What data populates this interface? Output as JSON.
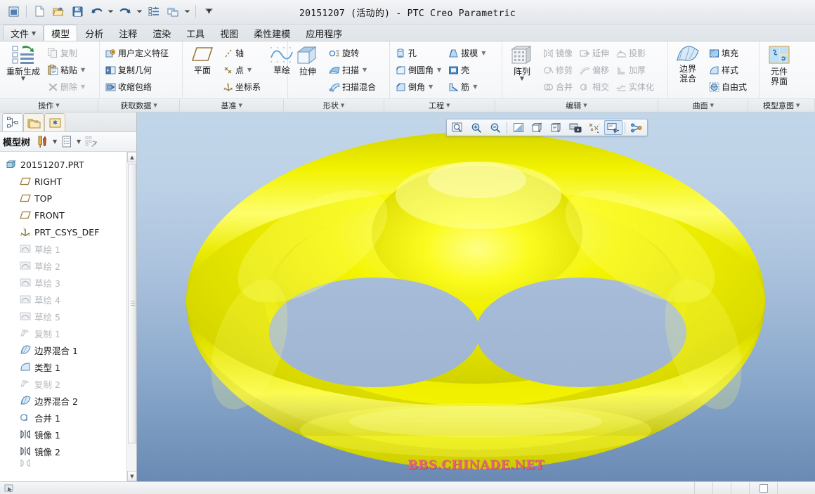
{
  "window": {
    "title": "20151207 (活动的) - PTC Creo Parametric"
  },
  "quick_access": {
    "buttons": [
      {
        "name": "window-restore-icon",
        "label": "窗口"
      },
      {
        "name": "new-file-icon",
        "label": "新建"
      },
      {
        "name": "open-file-icon",
        "label": "打开"
      },
      {
        "name": "save-icon",
        "label": "保存"
      },
      {
        "name": "undo-icon",
        "label": "撤消"
      },
      {
        "name": "redo-icon",
        "label": "重做"
      },
      {
        "name": "regenerate-icon",
        "label": "重新生成"
      },
      {
        "name": "window-switch-icon",
        "label": "窗口切换"
      },
      {
        "name": "customize-qat-icon",
        "label": "自定义快速访问工具栏"
      }
    ]
  },
  "ribbon": {
    "tabs": [
      {
        "label": "文件",
        "has_caret": true,
        "active": false,
        "is_file": true
      },
      {
        "label": "模型",
        "has_caret": false,
        "active": true,
        "is_file": false
      },
      {
        "label": "分析",
        "has_caret": false,
        "active": false,
        "is_file": false
      },
      {
        "label": "注释",
        "has_caret": false,
        "active": false,
        "is_file": false
      },
      {
        "label": "渲染",
        "has_caret": false,
        "active": false,
        "is_file": false
      },
      {
        "label": "工具",
        "has_caret": false,
        "active": false,
        "is_file": false
      },
      {
        "label": "视图",
        "has_caret": false,
        "active": false,
        "is_file": false
      },
      {
        "label": "柔性建模",
        "has_caret": false,
        "active": false,
        "is_file": false
      },
      {
        "label": "应用程序",
        "has_caret": false,
        "active": false,
        "is_file": false
      }
    ],
    "groups": [
      {
        "label": "操作",
        "big": {
          "label_line1": "重新生成",
          "label_line2": "",
          "icon": "regenerate-icon",
          "has_dropdown": true
        },
        "items": [
          {
            "label": "复制",
            "icon": "copy-icon",
            "dimmed": true,
            "dropdown": false
          },
          {
            "label": "粘贴",
            "icon": "paste-icon",
            "dimmed": false,
            "dropdown": true
          },
          {
            "label": "删除",
            "icon": "delete-icon",
            "dimmed": true,
            "dropdown": true
          }
        ]
      },
      {
        "label": "获取数据",
        "big": null,
        "items": [
          {
            "label": "用户定义特征",
            "icon": "udf-icon",
            "dimmed": false,
            "dropdown": false
          },
          {
            "label": "复制几何",
            "icon": "copy-geometry-icon",
            "dimmed": false,
            "dropdown": false
          },
          {
            "label": "收缩包络",
            "icon": "shrinkwrap-icon",
            "dimmed": false,
            "dropdown": false
          }
        ]
      },
      {
        "label": "基准",
        "big": {
          "label_line1": "平面",
          "label_line2": "",
          "icon": "datum-plane-icon",
          "has_dropdown": false
        },
        "items": [
          {
            "label": "轴",
            "icon": "datum-axis-icon",
            "dimmed": false,
            "dropdown": false
          },
          {
            "label": "点",
            "icon": "datum-point-icon",
            "dimmed": false,
            "dropdown": true
          },
          {
            "label": "坐标系",
            "icon": "coordinate-system-icon",
            "dimmed": false,
            "dropdown": false
          }
        ],
        "big2": {
          "label_line1": "草绘",
          "label_line2": "",
          "icon": "sketch-icon",
          "has_dropdown": false
        }
      },
      {
        "label": "形状",
        "big": {
          "label_line1": "拉伸",
          "label_line2": "",
          "icon": "extrude-icon",
          "has_dropdown": false
        },
        "items": [
          {
            "label": "旋转",
            "icon": "revolve-icon",
            "dimmed": false,
            "dropdown": false
          },
          {
            "label": "扫描",
            "icon": "sweep-icon",
            "dimmed": false,
            "dropdown": true
          },
          {
            "label": "扫描混合",
            "icon": "swept-blend-icon",
            "dimmed": false,
            "dropdown": false
          }
        ]
      },
      {
        "label": "工程",
        "big": null,
        "items": [
          {
            "label": "孔",
            "icon": "hole-icon",
            "dimmed": false,
            "dropdown": false
          },
          {
            "label": "倒圆角",
            "icon": "round-icon",
            "dimmed": false,
            "dropdown": true
          },
          {
            "label": "倒角",
            "icon": "chamfer-icon",
            "dimmed": false,
            "dropdown": true
          }
        ],
        "items2": [
          {
            "label": "拔模",
            "icon": "draft-icon",
            "dimmed": false,
            "dropdown": true
          },
          {
            "label": "壳",
            "icon": "shell-icon",
            "dimmed": false,
            "dropdown": false
          },
          {
            "label": "筋",
            "icon": "rib-icon",
            "dimmed": false,
            "dropdown": true
          }
        ]
      },
      {
        "label": "编辑",
        "big": {
          "label_line1": "阵列",
          "label_line2": "",
          "icon": "pattern-icon",
          "has_dropdown": true
        },
        "items": [
          {
            "label": "镜像",
            "icon": "mirror-icon",
            "dimmed": true,
            "dropdown": false
          },
          {
            "label": "修剪",
            "icon": "trim-icon",
            "dimmed": true,
            "dropdown": false
          },
          {
            "label": "合并",
            "icon": "merge-icon",
            "dimmed": true,
            "dropdown": false
          }
        ],
        "items2": [
          {
            "label": "延伸",
            "icon": "extend-icon",
            "dimmed": true,
            "dropdown": false
          },
          {
            "label": "偏移",
            "icon": "offset-icon",
            "dimmed": true,
            "dropdown": false
          },
          {
            "label": "相交",
            "icon": "intersect-icon",
            "dimmed": true,
            "dropdown": false
          }
        ],
        "items3": [
          {
            "label": "投影",
            "icon": "project-icon",
            "dimmed": true,
            "dropdown": false
          },
          {
            "label": "加厚",
            "icon": "thicken-icon",
            "dimmed": true,
            "dropdown": false
          },
          {
            "label": "实体化",
            "icon": "solidify-icon",
            "dimmed": true,
            "dropdown": false
          }
        ]
      },
      {
        "label": "曲面",
        "big": {
          "label_line1": "边界",
          "label_line2": "混合",
          "icon": "boundary-blend-icon",
          "has_dropdown": false
        },
        "items": [
          {
            "label": "填充",
            "icon": "fill-icon",
            "dimmed": false,
            "dropdown": false
          },
          {
            "label": "样式",
            "icon": "style-icon",
            "dimmed": false,
            "dropdown": false
          },
          {
            "label": "自由式",
            "icon": "freestyle-icon",
            "dimmed": false,
            "dropdown": false
          }
        ]
      },
      {
        "label": "模型意图",
        "big": {
          "label_line1": "元件",
          "label_line2": "界面",
          "icon": "component-interface-icon",
          "has_dropdown": false
        },
        "items": []
      }
    ]
  },
  "navigator": {
    "tabs": [
      {
        "name": "model-tree-tab",
        "label": "模型树",
        "state": "active"
      },
      {
        "name": "folder-browser-tab",
        "label": "文件夹浏览器",
        "state": "selected"
      },
      {
        "name": "favorites-tab",
        "label": "收藏夹",
        "state": "selected"
      }
    ],
    "tree_title": "模型树",
    "toolbar": [
      {
        "name": "tree-settings-icon",
        "label": "设置",
        "caret": true
      },
      {
        "name": "tree-display-icon",
        "label": "显示",
        "caret": true
      },
      {
        "name": "tree-filter-icon",
        "label": "过滤器",
        "caret": false
      }
    ],
    "tree": [
      {
        "label": "20151207.PRT",
        "icon": "part-icon",
        "level": 0,
        "dimmed": false
      },
      {
        "label": "RIGHT",
        "icon": "datum-plane-icon",
        "level": 1,
        "dimmed": false
      },
      {
        "label": "TOP",
        "icon": "datum-plane-icon",
        "level": 1,
        "dimmed": false
      },
      {
        "label": "FRONT",
        "icon": "datum-plane-icon",
        "level": 1,
        "dimmed": false
      },
      {
        "label": "PRT_CSYS_DEF",
        "icon": "coordinate-system-icon",
        "level": 1,
        "dimmed": false
      },
      {
        "label": "草绘 1",
        "icon": "sketch-feature-icon",
        "level": 1,
        "dimmed": true
      },
      {
        "label": "草绘 2",
        "icon": "sketch-feature-icon",
        "level": 1,
        "dimmed": true
      },
      {
        "label": "草绘 3",
        "icon": "sketch-feature-icon",
        "level": 1,
        "dimmed": true
      },
      {
        "label": "草绘 4",
        "icon": "sketch-feature-icon",
        "level": 1,
        "dimmed": true
      },
      {
        "label": "草绘 5",
        "icon": "sketch-feature-icon",
        "level": 1,
        "dimmed": true
      },
      {
        "label": "复制 1",
        "icon": "copy-feature-icon",
        "level": 1,
        "dimmed": true
      },
      {
        "label": "边界混合 1",
        "icon": "boundary-blend-feature-icon",
        "level": 1,
        "dimmed": false
      },
      {
        "label": "类型 1",
        "icon": "style-feature-icon",
        "level": 1,
        "dimmed": false
      },
      {
        "label": "复制 2",
        "icon": "copy-feature-icon",
        "level": 1,
        "dimmed": true
      },
      {
        "label": "边界混合 2",
        "icon": "boundary-blend-feature-icon",
        "level": 1,
        "dimmed": false
      },
      {
        "label": "合并 1",
        "icon": "merge-feature-icon",
        "level": 1,
        "dimmed": false
      },
      {
        "label": "镜像 1",
        "icon": "mirror-feature-icon",
        "level": 1,
        "dimmed": false
      },
      {
        "label": "镜像 2",
        "icon": "mirror-feature-icon",
        "level": 1,
        "dimmed": false
      }
    ]
  },
  "graphics_toolbar": {
    "buttons": [
      {
        "name": "refit-icon",
        "label": "重新调整",
        "pressed": false
      },
      {
        "name": "zoom-in-icon",
        "label": "放大",
        "pressed": false
      },
      {
        "name": "zoom-out-icon",
        "label": "缩小",
        "pressed": false
      },
      {
        "name": "repaint-icon",
        "label": "重画",
        "pressed": false
      },
      {
        "name": "display-style-icon",
        "label": "显示样式",
        "pressed": false
      },
      {
        "name": "perspective-view-icon",
        "label": "透视图",
        "pressed": false
      },
      {
        "name": "saved-views-icon",
        "label": "已保存方向",
        "pressed": false
      },
      {
        "name": "datum-display-icon",
        "label": "基准显示过滤器",
        "pressed": false
      },
      {
        "name": "annotation-display-icon",
        "label": "注释显示",
        "pressed": true
      },
      {
        "name": "spin-center-icon",
        "label": "旋转中心",
        "pressed": false
      }
    ]
  },
  "viewport": {
    "watermark": "BBS.CHINADE.NET",
    "model_color": "#e8e800",
    "background_top": "#c2d6ea",
    "background_bottom": "#6a8ab4"
  }
}
